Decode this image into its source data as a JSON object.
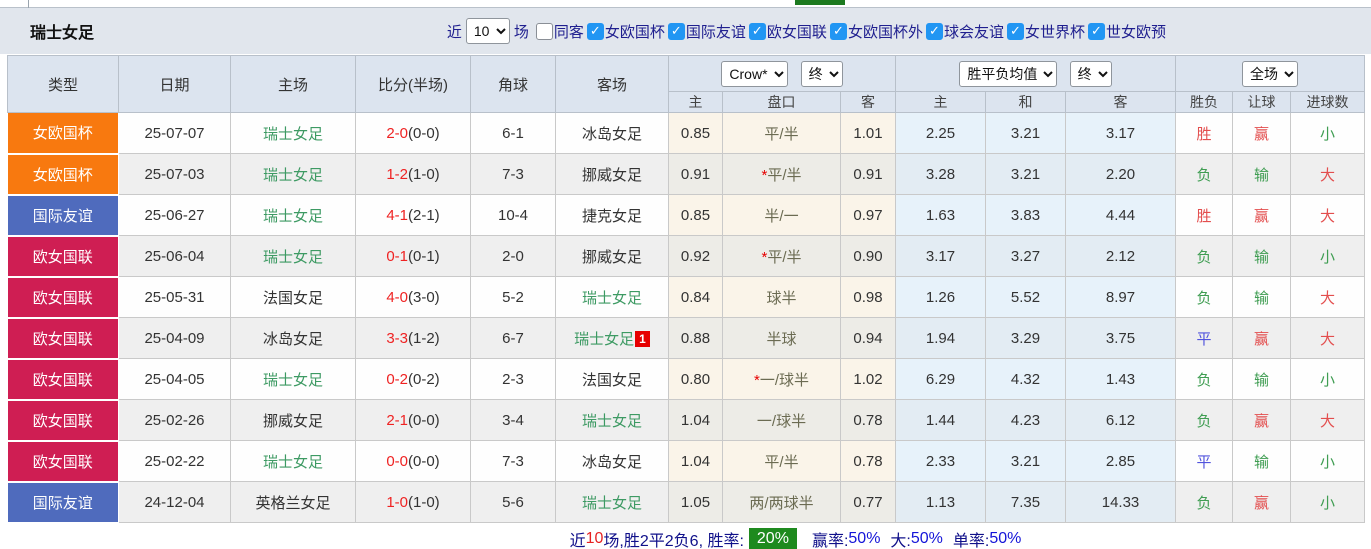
{
  "colors": {
    "cup_badge": "#f8790f",
    "friendly_badge": "#4f6bbd",
    "league_badge": "#cf1e53",
    "focus_team": "#3d9a63",
    "win_red": "#e34e4e",
    "loss_green": "#3f9d52",
    "draw_blue": "#5153dd",
    "score_red": "#ef2222",
    "rate_badge_bg": "#1e8a1e",
    "checkbox_blue": "#2196f3"
  },
  "topbar": {
    "title": "瑞士女足",
    "recent_label": "近",
    "recent_count": "10",
    "unit_label": "场",
    "same_away_label": "同客",
    "same_away_checked": false,
    "competitions": [
      {
        "label": "女欧国杯",
        "checked": true
      },
      {
        "label": "国际友谊",
        "checked": true
      },
      {
        "label": "欧女国联",
        "checked": true
      },
      {
        "label": "女欧国杯外",
        "checked": true
      },
      {
        "label": "球会友谊",
        "checked": true
      },
      {
        "label": "女世界杯",
        "checked": true
      },
      {
        "label": "世女欧预",
        "checked": true
      }
    ]
  },
  "table": {
    "main_headers": [
      "类型",
      "日期",
      "主场",
      "比分(半场)",
      "角球",
      "客场"
    ],
    "selects": {
      "odds_provider": "Crow*",
      "odds_stage": "终",
      "avg_label": "胜平负均值",
      "avg_stage": "终",
      "scope": "全场"
    },
    "sub_headers": [
      "主",
      "盘口",
      "客",
      "主",
      "和",
      "客",
      "胜负",
      "让球",
      "进球数"
    ],
    "rows": [
      {
        "type": "女欧国杯",
        "type_key": "cup",
        "date": "25-07-07",
        "home": "瑞士女足",
        "home_kind": "focus",
        "score": "2-0",
        "half": "(0-0)",
        "corner": "6-1",
        "away": "冰岛女足",
        "away_kind": "other",
        "away_badge": "",
        "hcap_home": "0.85",
        "hcap_star": "",
        "hcap_line": "平/半",
        "hcap_away": "1.01",
        "avg_home": "2.25",
        "avg_draw": "3.21",
        "avg_away": "3.17",
        "wdl": "胜",
        "wdl_color": "r",
        "hr": "赢",
        "hr_color": "r",
        "ou": "小",
        "ou_color": "g"
      },
      {
        "type": "女欧国杯",
        "type_key": "cup",
        "date": "25-07-03",
        "home": "瑞士女足",
        "home_kind": "focus",
        "score": "1-2",
        "half": "(1-0)",
        "corner": "7-3",
        "away": "挪威女足",
        "away_kind": "other",
        "away_badge": "",
        "hcap_home": "0.91",
        "hcap_star": "*",
        "hcap_line": "平/半",
        "hcap_away": "0.91",
        "avg_home": "3.28",
        "avg_draw": "3.21",
        "avg_away": "2.20",
        "wdl": "负",
        "wdl_color": "g",
        "hr": "输",
        "hr_color": "g",
        "ou": "大",
        "ou_color": "r"
      },
      {
        "type": "国际友谊",
        "type_key": "friendly",
        "date": "25-06-27",
        "home": "瑞士女足",
        "home_kind": "focus",
        "score": "4-1",
        "half": "(2-1)",
        "corner": "10-4",
        "away": "捷克女足",
        "away_kind": "other",
        "away_badge": "",
        "hcap_home": "0.85",
        "hcap_star": "",
        "hcap_line": "半/一",
        "hcap_away": "0.97",
        "avg_home": "1.63",
        "avg_draw": "3.83",
        "avg_away": "4.44",
        "wdl": "胜",
        "wdl_color": "r",
        "hr": "赢",
        "hr_color": "r",
        "ou": "大",
        "ou_color": "r"
      },
      {
        "type": "欧女国联",
        "type_key": "league",
        "date": "25-06-04",
        "home": "瑞士女足",
        "home_kind": "focus",
        "score": "0-1",
        "half": "(0-1)",
        "corner": "2-0",
        "away": "挪威女足",
        "away_kind": "other",
        "away_badge": "",
        "hcap_home": "0.92",
        "hcap_star": "*",
        "hcap_line": "平/半",
        "hcap_away": "0.90",
        "avg_home": "3.17",
        "avg_draw": "3.27",
        "avg_away": "2.12",
        "wdl": "负",
        "wdl_color": "g",
        "hr": "输",
        "hr_color": "g",
        "ou": "小",
        "ou_color": "g"
      },
      {
        "type": "欧女国联",
        "type_key": "league",
        "date": "25-05-31",
        "home": "法国女足",
        "home_kind": "other",
        "score": "4-0",
        "half": "(3-0)",
        "corner": "5-2",
        "away": "瑞士女足",
        "away_kind": "focus",
        "away_badge": "",
        "hcap_home": "0.84",
        "hcap_star": "",
        "hcap_line": "球半",
        "hcap_away": "0.98",
        "avg_home": "1.26",
        "avg_draw": "5.52",
        "avg_away": "8.97",
        "wdl": "负",
        "wdl_color": "g",
        "hr": "输",
        "hr_color": "g",
        "ou": "大",
        "ou_color": "r"
      },
      {
        "type": "欧女国联",
        "type_key": "league",
        "date": "25-04-09",
        "home": "冰岛女足",
        "home_kind": "other",
        "score": "3-3",
        "half": "(1-2)",
        "corner": "6-7",
        "away": "瑞士女足",
        "away_kind": "focus",
        "away_badge": "1",
        "hcap_home": "0.88",
        "hcap_star": "",
        "hcap_line": "半球",
        "hcap_away": "0.94",
        "avg_home": "1.94",
        "avg_draw": "3.29",
        "avg_away": "3.75",
        "wdl": "平",
        "wdl_color": "b",
        "hr": "赢",
        "hr_color": "r",
        "ou": "大",
        "ou_color": "r"
      },
      {
        "type": "欧女国联",
        "type_key": "league",
        "date": "25-04-05",
        "home": "瑞士女足",
        "home_kind": "focus",
        "score": "0-2",
        "half": "(0-2)",
        "corner": "2-3",
        "away": "法国女足",
        "away_kind": "other",
        "away_badge": "",
        "hcap_home": "0.80",
        "hcap_star": "*",
        "hcap_line": "一/球半",
        "hcap_away": "1.02",
        "avg_home": "6.29",
        "avg_draw": "4.32",
        "avg_away": "1.43",
        "wdl": "负",
        "wdl_color": "g",
        "hr": "输",
        "hr_color": "g",
        "ou": "小",
        "ou_color": "g"
      },
      {
        "type": "欧女国联",
        "type_key": "league",
        "date": "25-02-26",
        "home": "挪威女足",
        "home_kind": "other",
        "score": "2-1",
        "half": "(0-0)",
        "corner": "3-4",
        "away": "瑞士女足",
        "away_kind": "focus",
        "away_badge": "",
        "hcap_home": "1.04",
        "hcap_star": "",
        "hcap_line": "一/球半",
        "hcap_away": "0.78",
        "avg_home": "1.44",
        "avg_draw": "4.23",
        "avg_away": "6.12",
        "wdl": "负",
        "wdl_color": "g",
        "hr": "赢",
        "hr_color": "r",
        "ou": "大",
        "ou_color": "r"
      },
      {
        "type": "欧女国联",
        "type_key": "league",
        "date": "25-02-22",
        "home": "瑞士女足",
        "home_kind": "focus",
        "score": "0-0",
        "half": "(0-0)",
        "corner": "7-3",
        "away": "冰岛女足",
        "away_kind": "other",
        "away_badge": "",
        "hcap_home": "1.04",
        "hcap_star": "",
        "hcap_line": "平/半",
        "hcap_away": "0.78",
        "avg_home": "2.33",
        "avg_draw": "3.21",
        "avg_away": "2.85",
        "wdl": "平",
        "wdl_color": "b",
        "hr": "输",
        "hr_color": "g",
        "ou": "小",
        "ou_color": "g"
      },
      {
        "type": "国际友谊",
        "type_key": "friendly",
        "date": "24-12-04",
        "home": "英格兰女足",
        "home_kind": "other",
        "score": "1-0",
        "half": "(1-0)",
        "corner": "5-6",
        "away": "瑞士女足",
        "away_kind": "focus",
        "away_badge": "",
        "hcap_home": "1.05",
        "hcap_star": "",
        "hcap_line": "两/两球半",
        "hcap_away": "0.77",
        "avg_home": "1.13",
        "avg_draw": "7.35",
        "avg_away": "14.33",
        "wdl": "负",
        "wdl_color": "g",
        "hr": "赢",
        "hr_color": "r",
        "ou": "小",
        "ou_color": "g"
      }
    ]
  },
  "summary": {
    "recent_label": "近",
    "recent_count": "10",
    "stats_text": "场,胜2平2负6, 胜率:",
    "win_rate": "20%",
    "handicap_label": "赢率:",
    "handicap_rate": "50%",
    "big_label": "大:",
    "big_rate": "50%",
    "single_label": "单率:",
    "single_rate": "50%"
  }
}
